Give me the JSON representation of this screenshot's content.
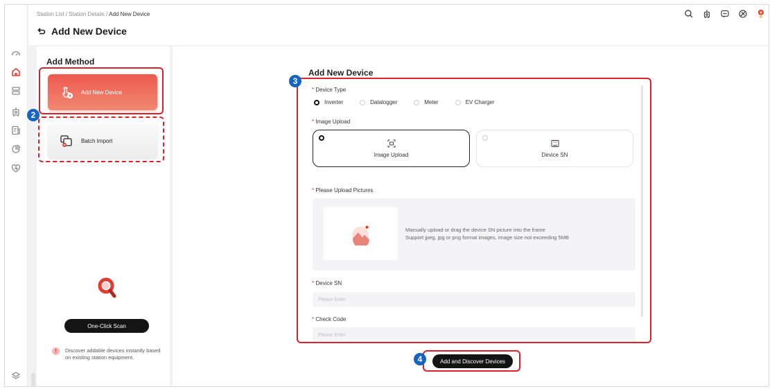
{
  "breadcrumb": {
    "items": [
      "Station List",
      "Station Details",
      "Add New Device"
    ],
    "separator": "/"
  },
  "page": {
    "title": "Add New Device"
  },
  "rail": {
    "items": [
      "dashboard-icon",
      "home-icon",
      "list-icon",
      "device-icon",
      "report-icon",
      "pie-chart-icon",
      "heart-icon",
      "layers-icon"
    ]
  },
  "topbar": {
    "icons": [
      "search-icon",
      "device-icon",
      "message-icon",
      "settings-icon",
      "avatar"
    ]
  },
  "left_panel": {
    "title": "Add Method",
    "methods": [
      {
        "label": "Add New Device",
        "active": true
      },
      {
        "label": "Batch Import",
        "active": false
      }
    ],
    "scan_button": "One-Click Scan",
    "note": "Discover addable devices instantly based on existing station equipment."
  },
  "form": {
    "title": "Add New Device",
    "device_type_label": "Device Type",
    "device_types": [
      {
        "label": "Inverter",
        "selected": true
      },
      {
        "label": "Datalogger",
        "selected": false
      },
      {
        "label": "Meter",
        "selected": false
      },
      {
        "label": "EV Charger",
        "selected": false
      }
    ],
    "image_upload_label": "Image Upload",
    "upload_options": [
      {
        "label": "Image Upload",
        "selected": true
      },
      {
        "label": "Device SN",
        "selected": false
      }
    ],
    "upload_pictures_label": "Please Upload Pictures",
    "upload_hint_1": "Manually upload or drag the device SN picture into the frame",
    "upload_hint_2": "Support jpeg, jpg or png format images, image size not exceeding 5MB",
    "device_sn_label": "Device SN",
    "device_sn_placeholder": "Please Enter",
    "check_code_label": "Check Code",
    "check_code_placeholder": "Please Enter"
  },
  "submit_button": "Add and Discover Devices",
  "annotations": [
    "2",
    "3",
    "4"
  ],
  "colors": {
    "accent": "#e03a2f",
    "highlight_outline": "#d9202b",
    "badge": "#1565c0",
    "button": "#141414"
  }
}
